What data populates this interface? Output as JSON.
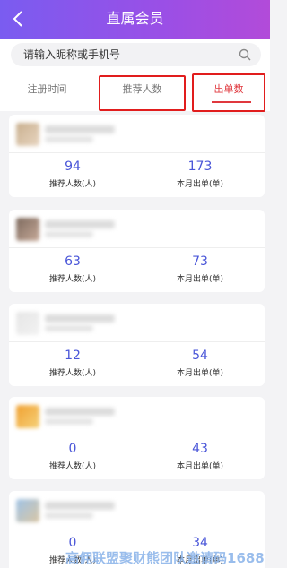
{
  "header": {
    "title": "直属会员",
    "back_icon": "chevron-left-icon"
  },
  "search": {
    "placeholder": "请输入昵称或手机号",
    "icon": "search-icon"
  },
  "tabs": [
    {
      "label": "注册时间"
    },
    {
      "label": "推荐人数"
    },
    {
      "label": "出单数"
    }
  ],
  "active_tab": "出单数",
  "colors": {
    "header_start": "#7a5cf0",
    "header_end": "#b24bd9",
    "active": "#e0383e",
    "number": "#4a56d8",
    "highlight_box": "#e11d1d"
  },
  "members": [
    {
      "referrals": "94",
      "referrals_label": "推荐人数(人)",
      "orders": "173",
      "orders_label": "本月出单(单)"
    },
    {
      "referrals": "63",
      "referrals_label": "推荐人数(人)",
      "orders": "73",
      "orders_label": "本月出单(单)"
    },
    {
      "referrals": "12",
      "referrals_label": "推荐人数(人)",
      "orders": "54",
      "orders_label": "本月出单(单)"
    },
    {
      "referrals": "0",
      "referrals_label": "推荐人数(人)",
      "orders": "43",
      "orders_label": "本月出单(单)"
    },
    {
      "referrals": "0",
      "referrals_label": "推荐人数(人)",
      "orders": "34",
      "orders_label": "本月出单(单)"
    }
  ],
  "watermark": "高佣联盟聚财熊团队邀请码1688"
}
